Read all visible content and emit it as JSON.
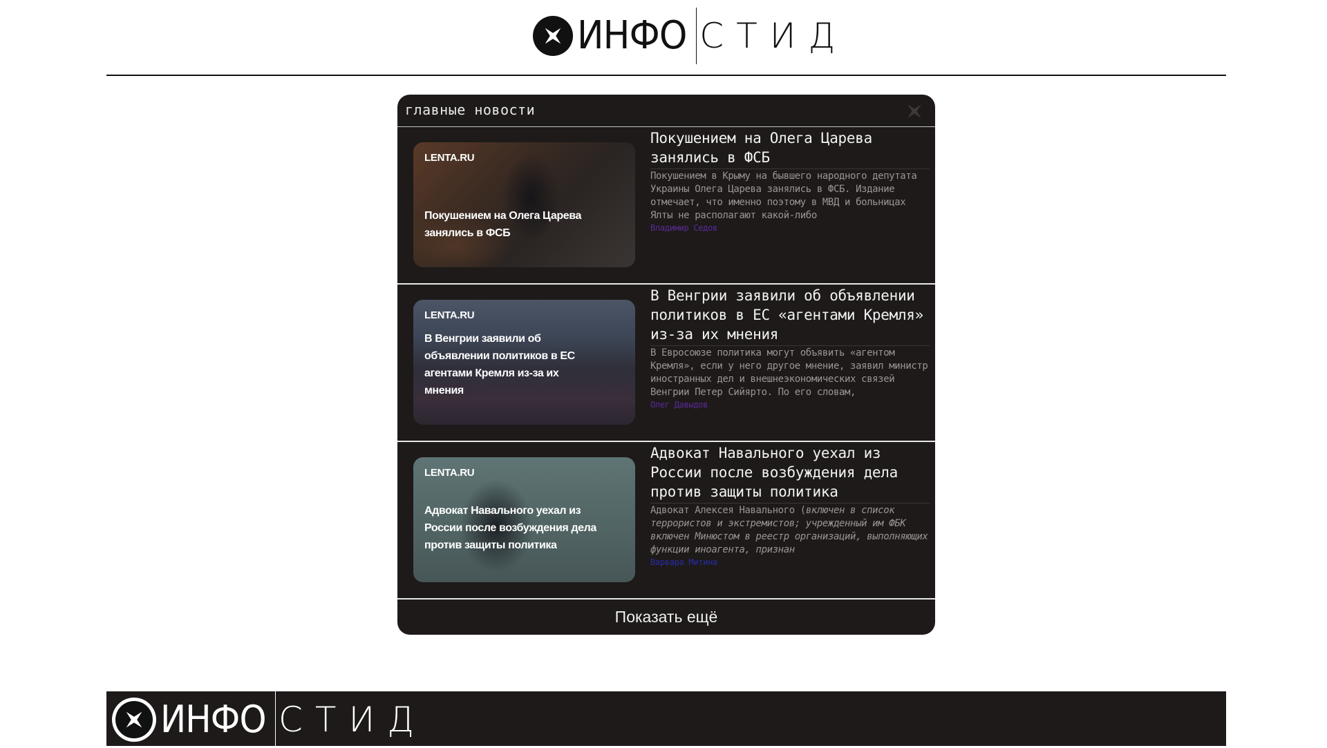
{
  "header": {
    "logo_part1": "ИНФО",
    "logo_part2": "СТИД"
  },
  "panel": {
    "title": "главные новости",
    "show_more_label": "Показать ещё"
  },
  "news": [
    {
      "source": "LENTA.RU",
      "thumb_caption": "Покушением на Олега Царева занялись в ФСБ",
      "title": "Покушением на Олега Царева занялись в ФСБ",
      "description": "Покушением в Крыму на бывшего народного депутата Украины Олега Царева занялись в ФСБ. Издание отмечает, что именно поэтому в МВД и больницах Ялты не располагают какой-либо",
      "author": "Владимир Седов",
      "author_color": "#5b2a9a"
    },
    {
      "source": "LENTA.RU",
      "thumb_caption": "В Венгрии заявили об объявлении политиков в ЕС агентами Кремля из-за их мнения",
      "title": "В Венгрии заявили об объявлении политиков в ЕС «агентами Кремля» из-за их мнения",
      "description": "В Евросоюзе политика могут объявить «агентом Кремля», если у него другое мнение, заявил министр иностранных дел и внешнеэкономических связей Венгрии Петер Сийярто. По его словам,",
      "author": "Олег Давыдов",
      "author_color": "#5b2a9a"
    },
    {
      "source": "LENTA.RU",
      "thumb_caption": "Адвокат Навального уехал из России после возбуждения дела против защиты политика",
      "title": "Адвокат Навального уехал из России после возбуждения дела против защиты политика",
      "description_start": "Адвокат Алексея Навального (",
      "description_italic": "включен в список террористов и экстремистов; учрежденный им ФБК включен Минюстом в реестр организаций, выполняющих функции иноагента, признан",
      "author": "Варвара Митина",
      "author_color": "#2a2aa8"
    }
  ],
  "footer": {
    "logo_part1": "ИНФО",
    "logo_part2": "СТИД"
  }
}
